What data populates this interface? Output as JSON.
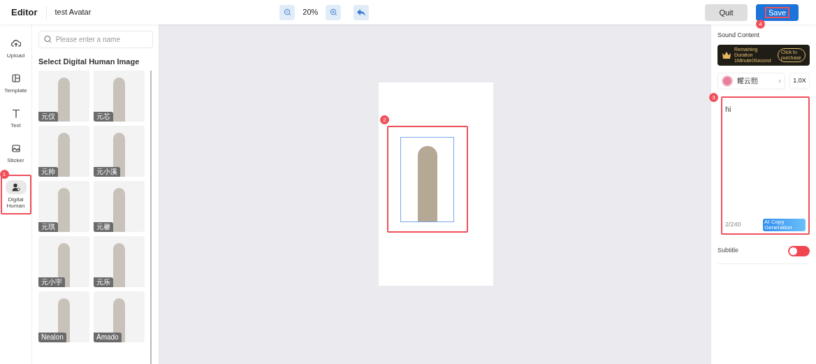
{
  "header": {
    "title": "Editor",
    "project_name": "test Avatar",
    "zoom": "20%",
    "buttons": [
      {
        "label": "Quit",
        "kind": "secondary"
      },
      {
        "label": "Save",
        "kind": "primary",
        "annotation": "4"
      }
    ]
  },
  "tool_rail": [
    {
      "label": "Upload",
      "selected": false
    },
    {
      "label": "Template",
      "selected": false
    },
    {
      "label": "Text",
      "selected": false
    },
    {
      "label": "Sticker",
      "selected": false
    },
    {
      "label": "Digital Human",
      "selected": true,
      "annotation": "1"
    }
  ],
  "library": {
    "search_placeholder": "Please enter a name",
    "heading": "Select Digital Human Image",
    "avatars": [
      {
        "name": "元仪"
      },
      {
        "name": "元芯"
      },
      {
        "name": "元帅"
      },
      {
        "name": "元小溪"
      },
      {
        "name": "元琪"
      },
      {
        "name": "元馨"
      },
      {
        "name": "元小宇"
      },
      {
        "name": "元乐"
      },
      {
        "name": "Nealon"
      },
      {
        "name": "Amado"
      }
    ]
  },
  "canvas": {
    "annotation": "2"
  },
  "sound": {
    "heading": "Sound Content",
    "duration_label": "Remaining Duration",
    "duration": "1Minute0Second",
    "purchase": "Click to purchase",
    "voice": "耀云熙",
    "chevron": "›",
    "speed": "1.0X",
    "script": "hi",
    "counter": "2/240",
    "ai_button": "AI Copy Generation",
    "annotation": "3"
  },
  "subtitle": {
    "label": "Subtitle",
    "on": false
  }
}
